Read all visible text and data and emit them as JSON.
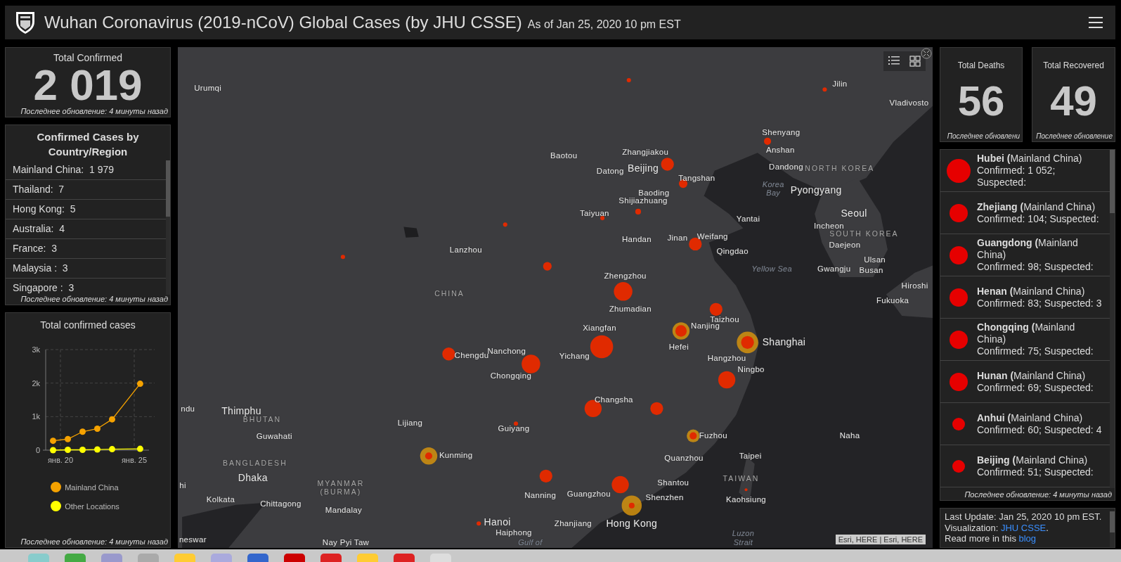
{
  "header": {
    "title": "Wuhan Coronavirus (2019-nCoV) Global Cases (by JHU CSSE)",
    "subtitle": "As of Jan 25, 2020 10 pm EST"
  },
  "total_confirmed": {
    "label": "Total Confirmed",
    "value": "2 019",
    "footer": "Последнее обновление: 4 минуты назад"
  },
  "country_list": {
    "title": "Confirmed Cases by Country/Region",
    "items": [
      {
        "text": "Mainland China:  1 979"
      },
      {
        "text": "Thailand:  7"
      },
      {
        "text": "Hong Kong:  5"
      },
      {
        "text": "Australia:  4"
      },
      {
        "text": "France:  3"
      },
      {
        "text": "Malaysia :  3"
      },
      {
        "text": "Singapore :  3"
      }
    ],
    "footer": "Последнее обновление: 4 минуты назад"
  },
  "chart_panel": {
    "title": "Total confirmed cases",
    "chart_data": {
      "type": "line",
      "x": [
        19.5,
        20.5,
        21.5,
        22.5,
        23.5,
        25.4
      ],
      "series": [
        {
          "name": "Mainland China",
          "color": "#f5a200",
          "marker": "circle",
          "values": [
            280,
            330,
            550,
            640,
            920,
            1980
          ]
        },
        {
          "name": "Other Locations",
          "color": "#ffff00",
          "marker": "circle",
          "values": [
            0,
            10,
            10,
            20,
            30,
            40
          ]
        }
      ],
      "grid": true,
      "xlim": [
        19,
        26
      ],
      "ylim": [
        0,
        3000
      ],
      "xticks": [
        {
          "value": 20,
          "label": "янв. 20"
        },
        {
          "value": 25,
          "label": "янв. 25"
        }
      ],
      "yticks": [
        {
          "value": 0,
          "label": "0"
        },
        {
          "value": 1000,
          "label": "1k"
        },
        {
          "value": 2000,
          "label": "2k"
        },
        {
          "value": 3000,
          "label": "3k"
        }
      ]
    },
    "footer": "Последнее обновление: 4 минуты назад"
  },
  "map": {
    "labels": [
      {
        "text": "Urumqi",
        "kind": "city"
      },
      {
        "text": "Jilin",
        "kind": "city"
      },
      {
        "text": "Vladivosto",
        "kind": "city"
      },
      {
        "text": "Shenyang",
        "kind": "city"
      },
      {
        "text": "Baotou",
        "kind": "city"
      },
      {
        "text": "Zhangjiakou",
        "kind": "city"
      },
      {
        "text": "Anshan",
        "kind": "city"
      },
      {
        "text": "Datong",
        "kind": "city"
      },
      {
        "text": "Beijing",
        "kind": "major"
      },
      {
        "text": "Dandong",
        "kind": "city"
      },
      {
        "text": "NORTH KOREA",
        "kind": "country"
      },
      {
        "text": "Tangshan",
        "kind": "city"
      },
      {
        "text": "Baoding",
        "kind": "city"
      },
      {
        "text": "Korea Bay",
        "kind": "water"
      },
      {
        "text": "Pyongyang",
        "kind": "major"
      },
      {
        "text": "Shijiazhuang",
        "kind": "city"
      },
      {
        "text": "Taiyuan",
        "kind": "city"
      },
      {
        "text": "Yantai",
        "kind": "city"
      },
      {
        "text": "Seoul",
        "kind": "major"
      },
      {
        "text": "Incheon",
        "kind": "city"
      },
      {
        "text": "Handan",
        "kind": "city"
      },
      {
        "text": "Jinan",
        "kind": "city"
      },
      {
        "text": "Weifang",
        "kind": "city"
      },
      {
        "text": "SOUTH KOREA",
        "kind": "country"
      },
      {
        "text": "Lanzhou",
        "kind": "city"
      },
      {
        "text": "Qingdao",
        "kind": "city"
      },
      {
        "text": "Daejeon",
        "kind": "city"
      },
      {
        "text": "Ulsan",
        "kind": "city"
      },
      {
        "text": "Zhengzhou",
        "kind": "city"
      },
      {
        "text": "Yellow Sea",
        "kind": "water"
      },
      {
        "text": "Gwangju",
        "kind": "city"
      },
      {
        "text": "Busan",
        "kind": "city"
      },
      {
        "text": "Hiroshi",
        "kind": "city"
      },
      {
        "text": "CHINA",
        "kind": "country"
      },
      {
        "text": "Fukuoka",
        "kind": "city"
      },
      {
        "text": "Zhumadian",
        "kind": "city"
      },
      {
        "text": "Taizhou",
        "kind": "city"
      },
      {
        "text": "Xiangfan",
        "kind": "city"
      },
      {
        "text": "Nanjing",
        "kind": "city"
      },
      {
        "text": "Chengdu",
        "kind": "city"
      },
      {
        "text": "Nanchong",
        "kind": "city"
      },
      {
        "text": "Yichang",
        "kind": "city"
      },
      {
        "text": "Hefei",
        "kind": "city"
      },
      {
        "text": "Hangzhou",
        "kind": "city"
      },
      {
        "text": "Shanghai",
        "kind": "major"
      },
      {
        "text": "Chongqing",
        "kind": "city"
      },
      {
        "text": "Ningbo",
        "kind": "city"
      },
      {
        "text": "Changsha",
        "kind": "city"
      },
      {
        "text": "ndu",
        "kind": "city"
      },
      {
        "text": "Thimphu",
        "kind": "major"
      },
      {
        "text": "BHUTAN",
        "kind": "country"
      },
      {
        "text": "Lijiang",
        "kind": "city"
      },
      {
        "text": "Guiyang",
        "kind": "city"
      },
      {
        "text": "Guwahati",
        "kind": "city"
      },
      {
        "text": "Fuzhou",
        "kind": "city"
      },
      {
        "text": "Naha",
        "kind": "city"
      },
      {
        "text": "Kunming",
        "kind": "city"
      },
      {
        "text": "Quanzhou",
        "kind": "city"
      },
      {
        "text": "Taipei",
        "kind": "city"
      },
      {
        "text": "BANGLADESH",
        "kind": "country"
      },
      {
        "text": "hi",
        "kind": "city"
      },
      {
        "text": "Kolkata",
        "kind": "city"
      },
      {
        "text": "Dhaka",
        "kind": "major"
      },
      {
        "text": "Chittagong",
        "kind": "city"
      },
      {
        "text": "MYANMAR (BURMA)",
        "kind": "country"
      },
      {
        "text": "Nanning",
        "kind": "city"
      },
      {
        "text": "Guangzhou",
        "kind": "city"
      },
      {
        "text": "Shantou",
        "kind": "city"
      },
      {
        "text": "Shenzhen",
        "kind": "city"
      },
      {
        "text": "TAIWAN",
        "kind": "country"
      },
      {
        "text": "Kaohsiung",
        "kind": "city"
      },
      {
        "text": "Mandalay",
        "kind": "city"
      },
      {
        "text": "Hanoi",
        "kind": "major"
      },
      {
        "text": "Zhanjiang",
        "kind": "city"
      },
      {
        "text": "Hong Kong",
        "kind": "major"
      },
      {
        "text": "Haiphong",
        "kind": "city"
      },
      {
        "text": "Luzon",
        "kind": "water"
      },
      {
        "text": "neswar",
        "kind": "city"
      },
      {
        "text": "Nay Pyi Taw",
        "kind": "city"
      },
      {
        "text": "Gulf of",
        "kind": "water"
      },
      {
        "text": "Strait",
        "kind": "water"
      }
    ],
    "attribution": "Esri, HERE | Esri, HERE"
  },
  "total_deaths": {
    "label": "Total Deaths",
    "value": "56",
    "footer": "Последнее обновлени"
  },
  "total_recovered": {
    "label": "Total Recovered",
    "value": "49",
    "footer": "Последнее обновление"
  },
  "province_list": {
    "items": [
      {
        "name": "**Hubei (**Mainland China)",
        "details": "Confirmed: 1 052; Suspected:"
      },
      {
        "name": "**Zhejiang (**Mainland China)",
        "details": "Confirmed: 104; Suspected:"
      },
      {
        "name": "**Guangdong (**Mainland China)",
        "details": "Confirmed: 98; Suspected:"
      },
      {
        "name": "**Henan (**Mainland China)",
        "details": "Confirmed: 83; Suspected: 3"
      },
      {
        "name": "**Chongqing (**Mainland China)",
        "details": "Confirmed: 75; Suspected:"
      },
      {
        "name": "**Hunan (**Mainland China)",
        "details": "Confirmed: 69; Suspected:"
      },
      {
        "name": "**Anhui (**Mainland China)",
        "details": "Confirmed: 60; Suspected: 4"
      },
      {
        "name": "**Beijing (**Mainland China)",
        "details": "Confirmed: 51; Suspected:"
      }
    ],
    "footer": "Последнее обновление: 4 минуты назад"
  },
  "last_update": {
    "text": "Last Update: Jan 25, 2020 10 pm EST.",
    "visualization_prefix": "Visualization:",
    "visualization_link": "JHU CSSE",
    "visualization_suffix": ".",
    "read_more_prefix": "Read more in this",
    "read_more_link": "blog"
  }
}
